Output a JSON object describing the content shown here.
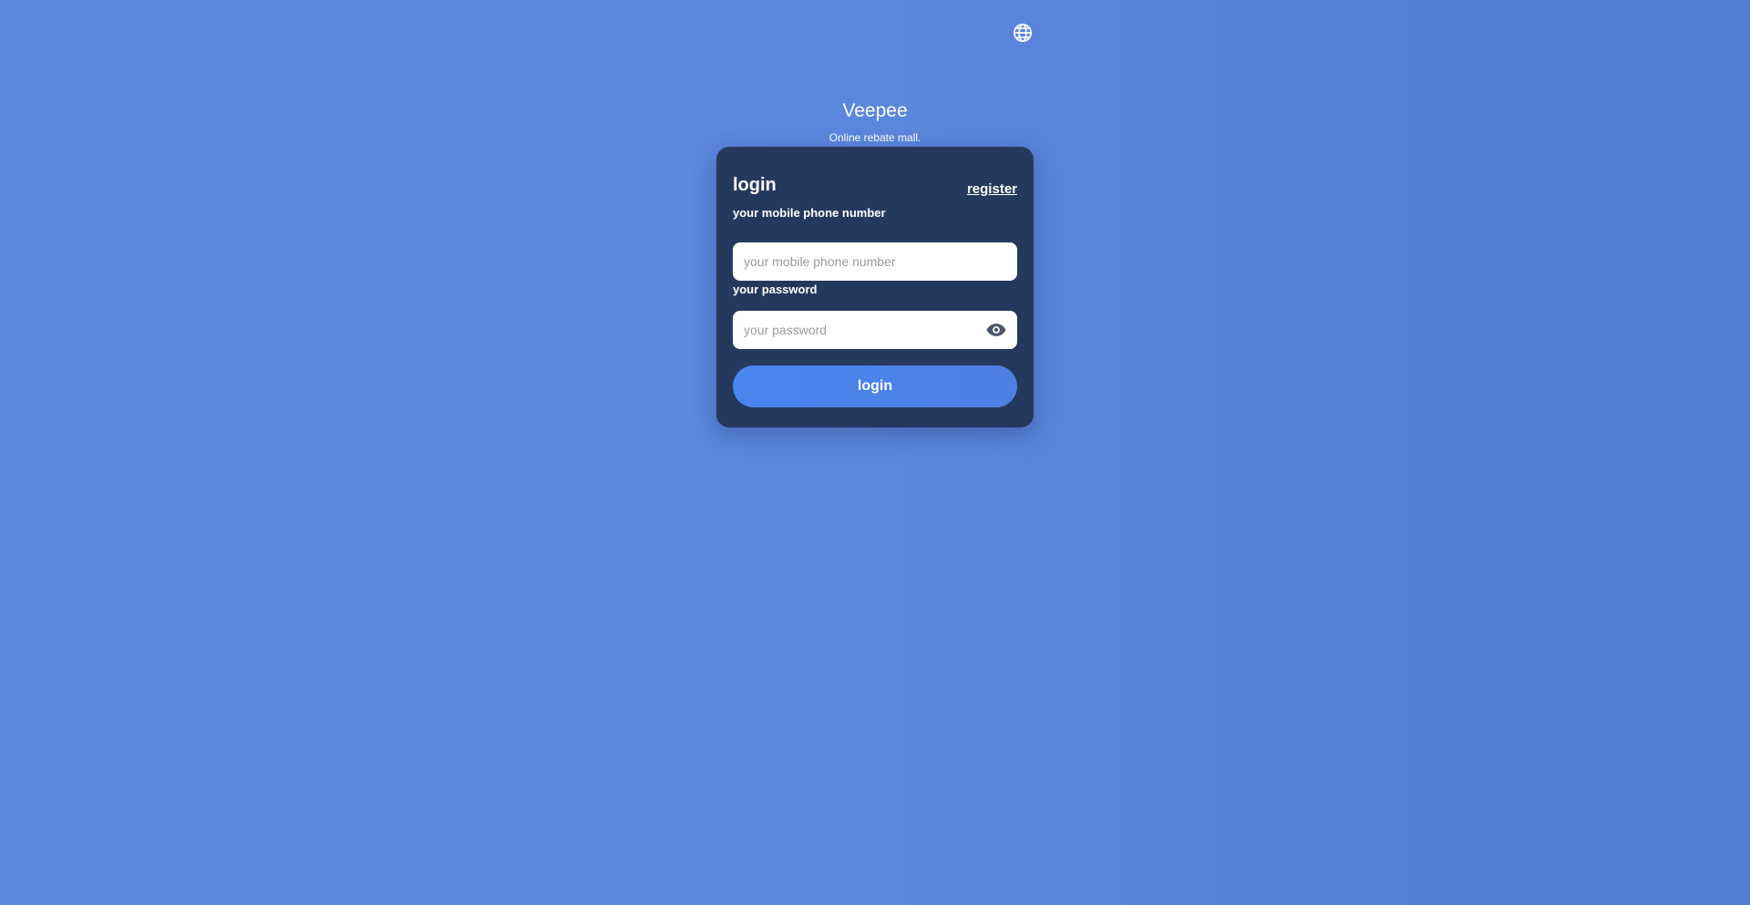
{
  "header": {
    "language_icon": "globe-icon"
  },
  "brand": {
    "title": "Veepee",
    "tagline": "Online rebate mall."
  },
  "login_form": {
    "title": "login",
    "register_label": "register",
    "phone": {
      "label": "your mobile phone number",
      "placeholder": "your mobile phone number",
      "value": ""
    },
    "password": {
      "label": "your password",
      "placeholder": "your password",
      "value": "",
      "toggle_icon": "eye-icon"
    },
    "submit_label": "login"
  },
  "colors": {
    "background": "#5b86db",
    "card": "#25395f",
    "accent": "#4a86ef",
    "text": "#ffffff"
  }
}
